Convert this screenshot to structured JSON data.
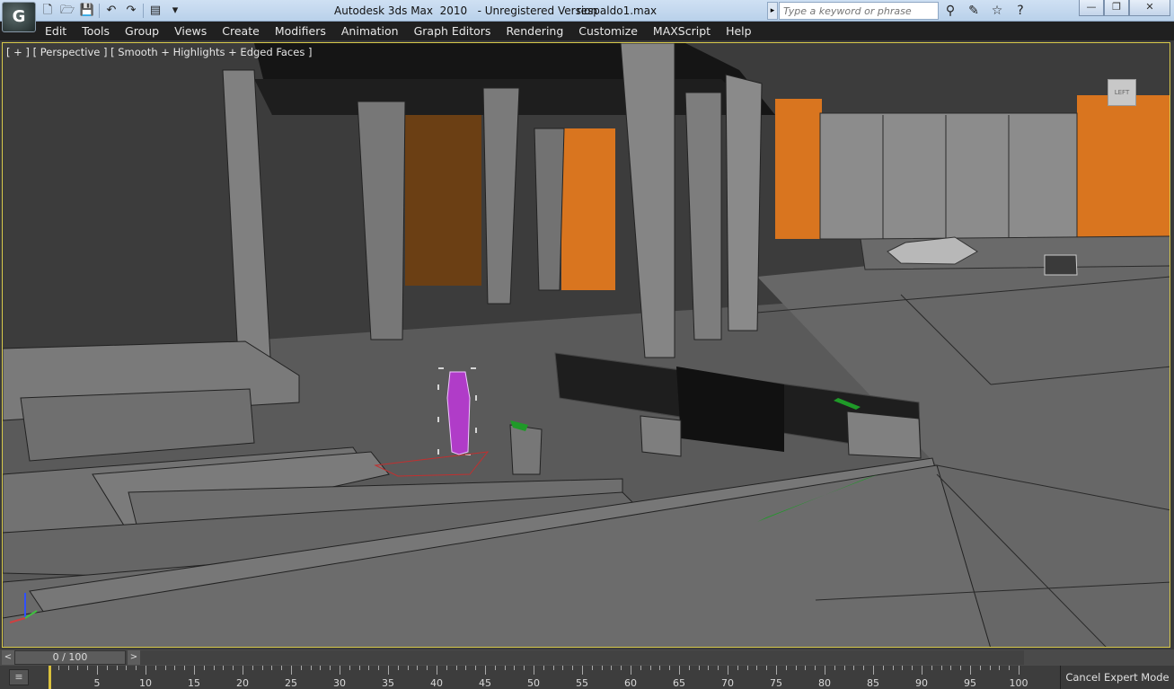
{
  "window": {
    "title": "Autodesk 3ds Max  2010   - Unregistered Version",
    "file": "respaldo1.max"
  },
  "app_logo": "G",
  "quick_access": [
    {
      "name": "new-file-icon",
      "glyph": "🗋"
    },
    {
      "name": "open-file-icon",
      "glyph": "🗁"
    },
    {
      "name": "save-icon",
      "glyph": "💾"
    },
    {
      "name": "undo-icon",
      "glyph": "↶"
    },
    {
      "name": "redo-icon",
      "glyph": "↷"
    },
    {
      "name": "project-folder-icon",
      "glyph": "▤"
    },
    {
      "name": "customize-dropdown-icon",
      "glyph": "▾"
    }
  ],
  "search": {
    "placeholder": "Type a keyword or phrase",
    "arrow": "▸"
  },
  "help_icons": [
    {
      "name": "binoculars-icon",
      "glyph": "⚲"
    },
    {
      "name": "communication-center-icon",
      "glyph": "✎"
    },
    {
      "name": "favorites-star-icon",
      "glyph": "☆"
    },
    {
      "name": "help-icon",
      "glyph": "?"
    }
  ],
  "window_controls": {
    "minimize": "—",
    "restore": "❐",
    "close": "✕"
  },
  "menu": [
    "Edit",
    "Tools",
    "Group",
    "Views",
    "Create",
    "Modifiers",
    "Animation",
    "Graph Editors",
    "Rendering",
    "Customize",
    "MAXScript",
    "Help"
  ],
  "viewport": {
    "label": "[ + ] [ Perspective ] [ Smooth + Highlights + Edged Faces ]",
    "viewcube_label": "LEFT"
  },
  "time_slider": {
    "position": "0 / 100",
    "prev": "<",
    "next": ">",
    "current_frame": 0,
    "total_frames": 100
  },
  "track_bar": {
    "icon": "≡",
    "ticks": [
      5,
      10,
      15,
      20,
      25,
      30,
      35,
      40,
      45,
      50,
      55,
      60,
      65,
      70,
      75,
      80,
      85,
      90,
      95,
      100
    ]
  },
  "status": {
    "cancel_expert_mode": "Cancel Expert Mode"
  },
  "colors": {
    "accent_orange": "#d9751f",
    "selection_purple": "#b03cc8",
    "green_strip": "#1f9a28",
    "viewport_border": "#d7c94a"
  }
}
